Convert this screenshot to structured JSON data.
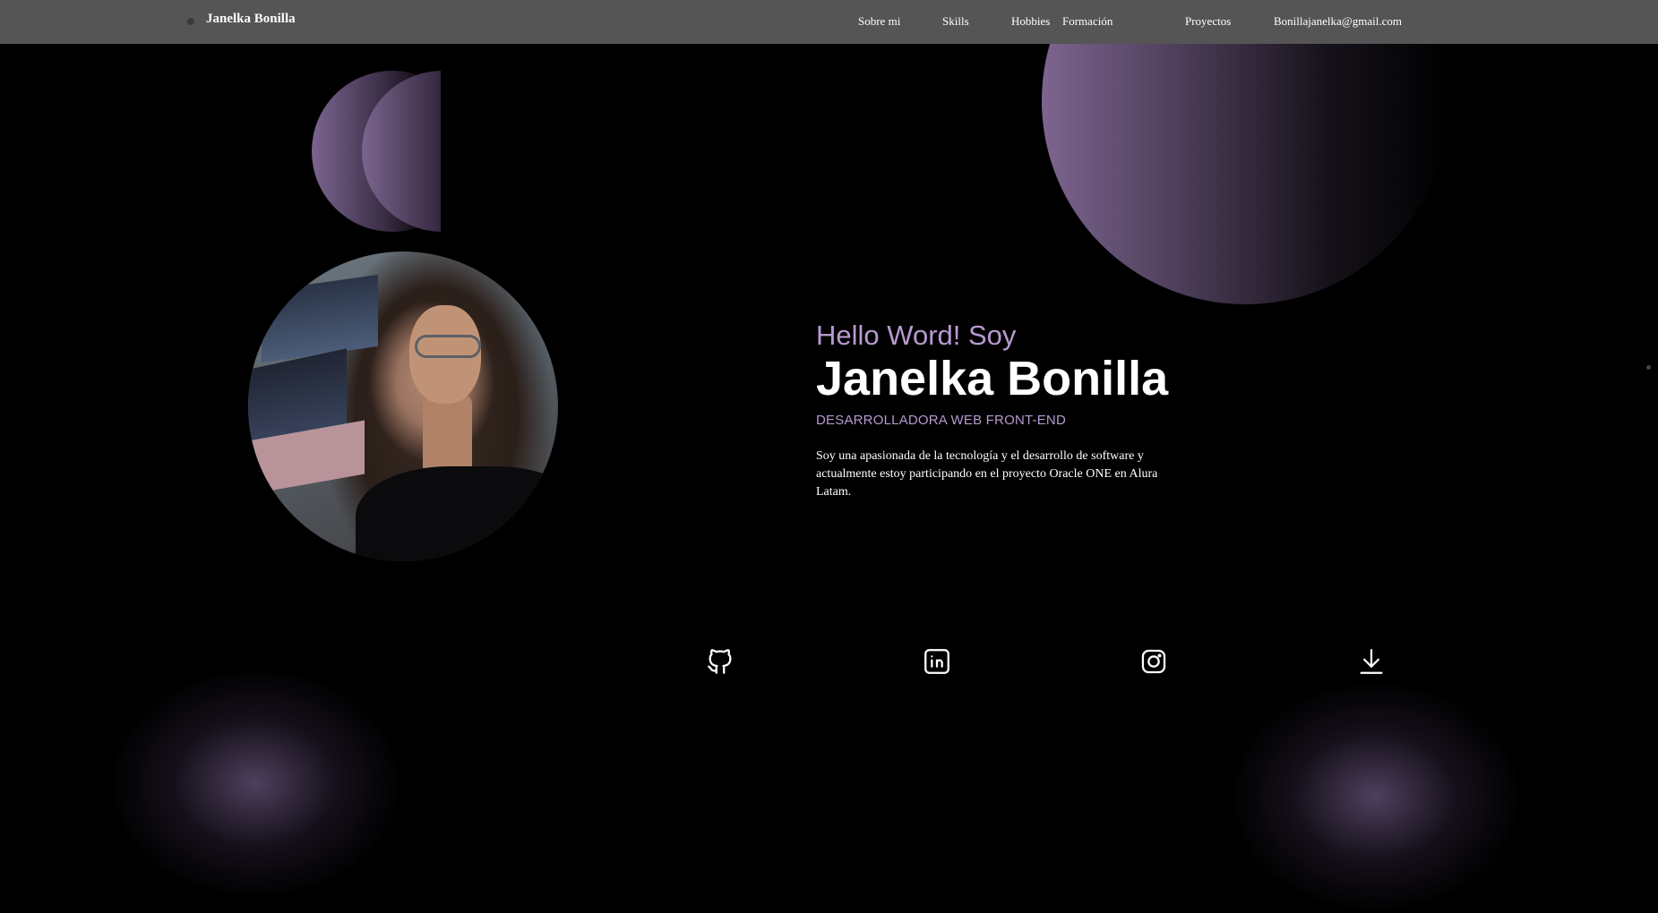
{
  "nav": {
    "brand": "Janelka Bonilla",
    "links": [
      "Sobre mi",
      "Skills",
      "Hobbies",
      "Formación",
      "Proyectos",
      "Bonillajanelka@gmail.com"
    ]
  },
  "hero": {
    "greeting": "Hello Word! Soy",
    "name": "Janelka Bonilla",
    "role": "DESARROLLADORA WEB FRONT-END",
    "bio": "Soy una apasionada de la tecnología y el desarrollo de software y actualmente estoy participando en el proyecto Oracle ONE en Alura Latam."
  },
  "social": {
    "icons": [
      "github-icon",
      "linkedin-icon",
      "instagram-icon",
      "download-icon"
    ]
  },
  "colors": {
    "accent": "#b79ad0",
    "nav_bg": "#555555",
    "background": "#000000"
  }
}
